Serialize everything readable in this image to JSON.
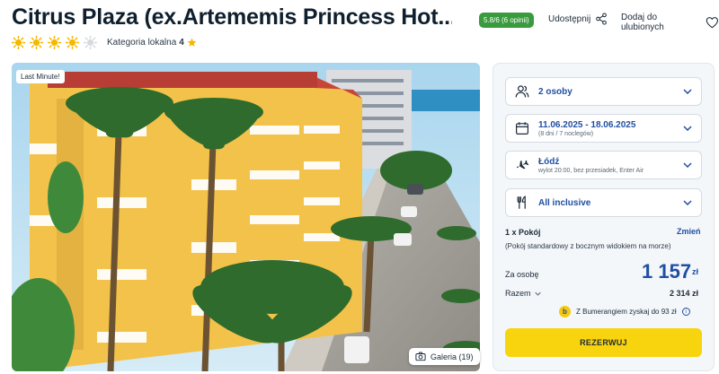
{
  "header": {
    "title": "Citrus Plaza (ex.Artememis Princess Hot...",
    "stars_filled": 4,
    "stars_total": 5,
    "category_label": "Kategoria lokalna",
    "category_value": "4",
    "rating_badge": "5.8/6 (6 opinii)",
    "share_label": "Udostępnij",
    "favorite_label": "Dodaj do ulubionych"
  },
  "photo": {
    "badge": "Last Minute!",
    "gallery_label": "Galeria (19)"
  },
  "booking": {
    "guests": "2 osoby",
    "dates": "11.06.2025 - 18.06.2025",
    "dates_sub": "(8 dni / 7 noclegów)",
    "departure": "Łódź",
    "departure_sub": "wylot 20:00, bez przesiadek, Enter Air",
    "board": "All inclusive",
    "room_count": "1 x Pokój",
    "room_change": "Zmień",
    "room_desc": "(Pokój standardowy z bocznym widokiem na morze)",
    "per_person_label": "Za osobę",
    "per_person_price": "1 157",
    "currency": "zł",
    "total_label": "Razem",
    "total_price": "2 314 zł",
    "bumerang_text": "Z Bumerangiem zyskaj do 93 zł",
    "bumerang_logo": "b",
    "book_button": "REZERWUJ"
  },
  "colors": {
    "accent_blue": "#1f4fa3",
    "rating_green": "#3a9a3e",
    "book_yellow": "#f8d40e",
    "star_yellow": "#f5b800"
  },
  "icons": [
    "sun-star-icon",
    "share-icon",
    "heart-icon",
    "users-icon",
    "calendar-icon",
    "plane-icon",
    "cutlery-icon",
    "chevron-down-icon",
    "camera-icon",
    "info-icon"
  ]
}
